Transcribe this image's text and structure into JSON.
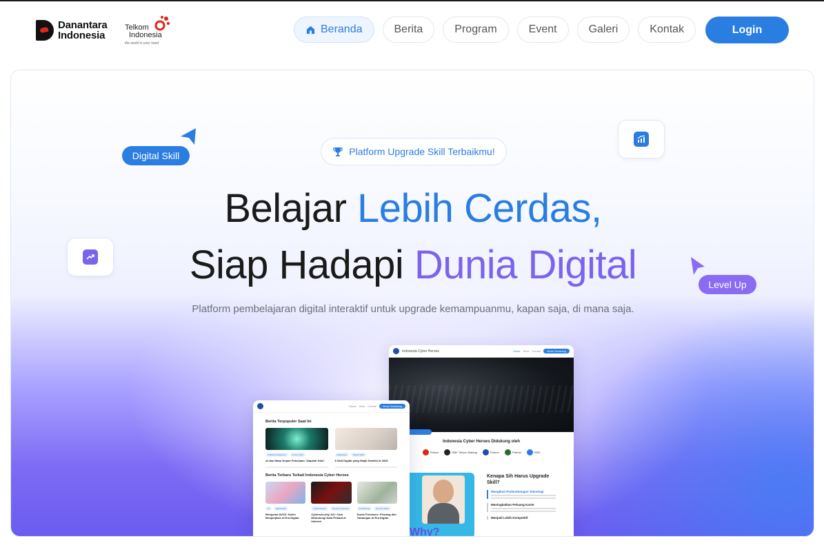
{
  "header": {
    "brand_primary": "Danantara Indonesia",
    "brand_primary_line1": "Danantara",
    "brand_primary_line2": "Indonesia",
    "brand_secondary_line1": "Telkom",
    "brand_secondary_line2": "Indonesia",
    "brand_secondary_tagline": "the world in your hand",
    "nav": [
      {
        "label": "Beranda",
        "active": true,
        "icon": "home-icon"
      },
      {
        "label": "Berita",
        "active": false
      },
      {
        "label": "Program",
        "active": false
      },
      {
        "label": "Event",
        "active": false
      },
      {
        "label": "Galeri",
        "active": false
      },
      {
        "label": "Kontak",
        "active": false
      }
    ],
    "login_label": "Login"
  },
  "hero": {
    "badge": "Platform Upgrade Skill Terbaikmu!",
    "badge_icon": "trophy-icon",
    "title_line1_plain": "Belajar ",
    "title_line1_accent": "Lebih Cerdas,",
    "title_line2_plain": "Siap Hadapi ",
    "title_line2_accent": "Dunia Digital",
    "subtitle": "Platform pembelajaran digital interaktif untuk upgrade kemampuanmu, kapan saja, di mana saja.",
    "chip_left": "Digital Skill",
    "chip_right": "Level Up",
    "tile_left_icon": "trending-up-icon",
    "tile_right_icon": "bar-chart-icon",
    "colors": {
      "blue": "#2a7de1",
      "purple": "#7b63ee"
    }
  },
  "mock_back": {
    "brand": "Indonesia Cyber Heroes",
    "nav": [
      "Home",
      "Hero",
      "Course"
    ],
    "cta": "Mulai Sekarang",
    "supported_title": "Indonesia Cyber Heroes Didukung oleh",
    "partners": [
      "Telkom",
      "SMK Telkom Malang",
      "Partner",
      "Partner",
      "BSN"
    ],
    "why_label": "Why?",
    "section_title": "Kenapa Sih Harus Upgrade Skill?",
    "items": [
      "Mengikuti Perkembangan Teknologi",
      "Meningkatkan Peluang Karier",
      "Menjadi Lebih Kompetitif"
    ]
  },
  "mock_front": {
    "nav": [
      "Home",
      "Hero",
      "Course"
    ],
    "cta": "Mulai Sekarang",
    "popular_title": "Berita Terpopuler Saat Ini",
    "popular": [
      {
        "tags": [
          "Artificial Intelligence",
          "Future Work"
        ],
        "caption": "AI dan Masa Depan Pekerjaan: Siapkah Kita?"
      },
      {
        "tags": [
          "Digitalisasi",
          "Digital Skills"
        ],
        "caption": "5 Skill Digital yang Wajib Dimiliki di 2025"
      }
    ],
    "latest_title": "Berita Terbaru Terkait Indonesia Cyber Heroes",
    "latest": [
      {
        "tags": [
          "AI",
          "Digital Skill"
        ],
        "caption": "Mengenal AI/UX: Karier Menjanjikan di Era Digital"
      },
      {
        "tags": [
          "Cybersecurity",
          "Privacy Protection"
        ],
        "caption": "Cybersecurity 101: Cara Melindungi Data Pribadi di Internet"
      },
      {
        "tags": [
          "Freelancing",
          "Remote Work"
        ],
        "caption": "Dunia Freelance: Peluang dan Tantangan di Era Digital"
      }
    ]
  }
}
